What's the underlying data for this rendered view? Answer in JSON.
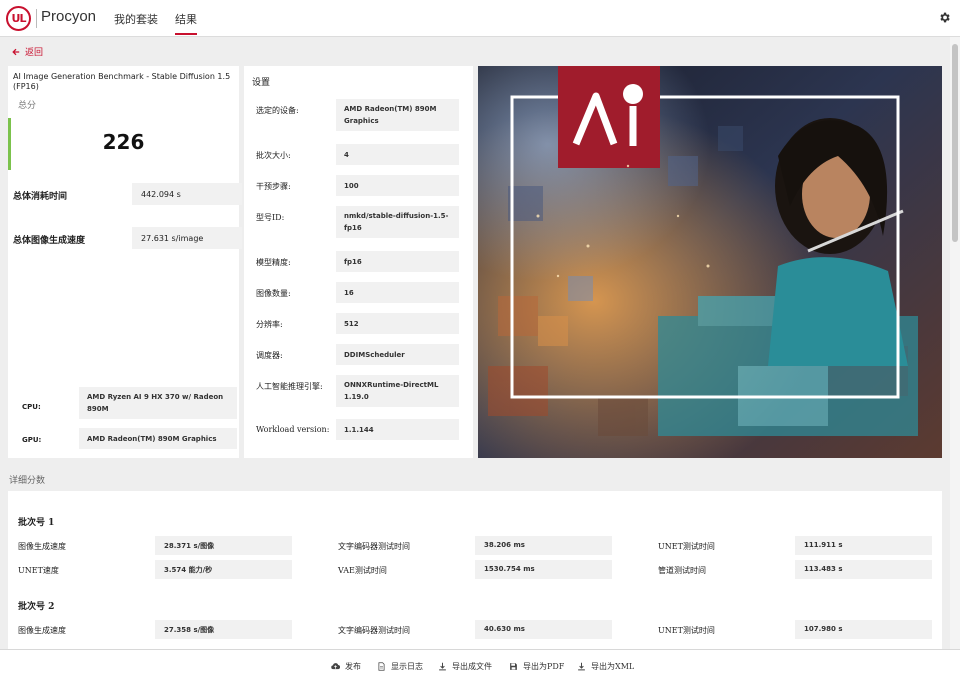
{
  "header": {
    "logo_text": "UL",
    "brand": "Procyon",
    "tabs": [
      {
        "label": "我的套装",
        "active": false
      },
      {
        "label": "结果",
        "active": true
      }
    ]
  },
  "nav": {
    "back_label": "返回"
  },
  "summary": {
    "title": "AI Image Generation Benchmark - Stable Diffusion 1.5 (FP16)",
    "score_label": "总分",
    "score": "226",
    "metrics": [
      {
        "label": "总体消耗时间",
        "value": "442.094 s"
      },
      {
        "label": "总体图像生成速度",
        "value": "27.631 s/image"
      }
    ],
    "hardware": [
      {
        "label": "CPU:",
        "value": "AMD Ryzen AI 9 HX 370 w/ Radeon 890M"
      },
      {
        "label": "GPU:",
        "value": "AMD Radeon(TM) 890M Graphics"
      }
    ]
  },
  "settings": {
    "title": "设置",
    "rows": [
      {
        "label": "选定的设备:",
        "value": "AMD Radeon(TM) 890M Graphics"
      },
      {
        "label": "批次大小:",
        "value": "4"
      },
      {
        "label": "干预步骤:",
        "value": "100"
      },
      {
        "label": "型号ID:",
        "value": "nmkd/stable-diffusion-1.5-fp16"
      },
      {
        "label": "模型精度:",
        "value": "fp16"
      },
      {
        "label": "图像数量:",
        "value": "16"
      },
      {
        "label": "分辨率:",
        "value": "512"
      },
      {
        "label": "调度器:",
        "value": "DDIMScheduler"
      },
      {
        "label": "人工智能推理引擎:",
        "value": "ONNXRuntime-DirectML 1.19.0"
      },
      {
        "label": "Workload version:",
        "value": "1.1.144"
      }
    ]
  },
  "hero": {
    "badge_text": "AI",
    "colors": {
      "badge": "#a01c2c"
    }
  },
  "details": {
    "title": "详细分数",
    "batches": [
      {
        "title": "批次号 1",
        "rows": [
          [
            {
              "label": "图像生成速度",
              "value": "28.371 s/图像"
            },
            {
              "label": "文字编码器测试时间",
              "value": "38.206 ms"
            },
            {
              "label": "UNET测试时间",
              "value": "111.911 s"
            }
          ],
          [
            {
              "label": "UNET速度",
              "value": "3.574 能力/秒"
            },
            {
              "label": "VAE测试时间",
              "value": "1530.754 ms"
            },
            {
              "label": "管道测试时间",
              "value": "113.483 s"
            }
          ]
        ]
      },
      {
        "title": "批次号 2",
        "rows": [
          [
            {
              "label": "图像生成速度",
              "value": "27.358 s/图像"
            },
            {
              "label": "文字编码器测试时间",
              "value": "40.630 ms"
            },
            {
              "label": "UNET测试时间",
              "value": "107.980 s"
            }
          ]
        ]
      }
    ]
  },
  "footer": {
    "buttons": [
      {
        "label": "发布",
        "icon": "cloud-upload-icon"
      },
      {
        "label": "显示日志",
        "icon": "document-icon"
      },
      {
        "label": "导出成文件",
        "icon": "download-icon"
      },
      {
        "label": "导出为PDF",
        "icon": "save-icon"
      },
      {
        "label": "导出为XML",
        "icon": "download-icon"
      }
    ]
  },
  "colors": {
    "accent": "#c8102e",
    "score_bar": "#7bc24c"
  }
}
